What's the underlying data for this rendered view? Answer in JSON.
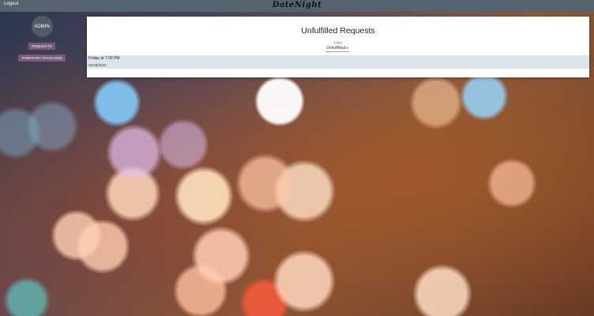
{
  "header": {
    "logout_label": "Logout",
    "brand": "DateNight"
  },
  "sidebar": {
    "avatar_text": "ADMIN",
    "items": [
      {
        "label": "REQUESTS"
      },
      {
        "label": "ITINERARY PACKAGES"
      }
    ]
  },
  "main": {
    "title": "Unfulfilled Requests",
    "filter": {
      "label": "Filter",
      "selected": "Unfulfilled"
    },
    "requests": [
      {
        "title": "Friday at 7:00 PM",
        "date": "02/28/2020"
      }
    ]
  },
  "colors": {
    "topbar": "#55626f",
    "nav_button": "#7b5a75",
    "avatar": "#4f5b66",
    "request_row": "#dbe6ec"
  }
}
